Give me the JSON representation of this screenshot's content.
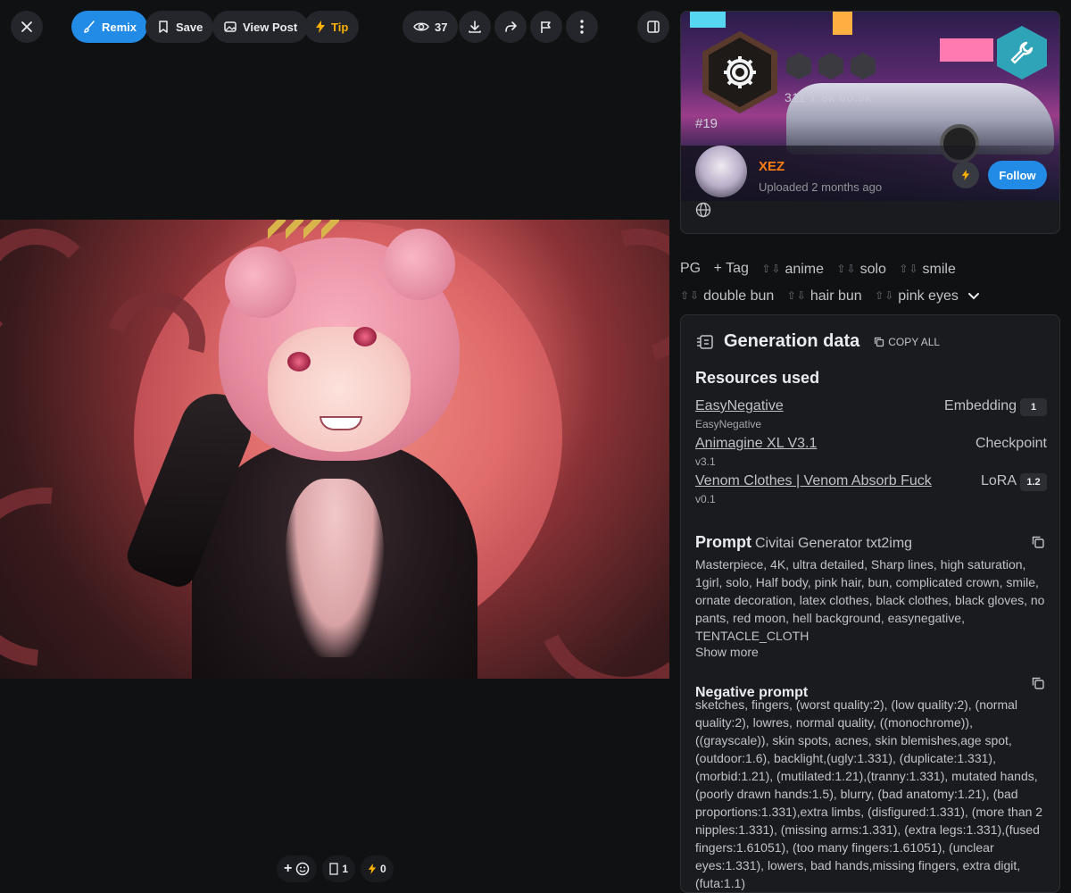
{
  "toolbar": {
    "remix": "Remix",
    "save": "Save",
    "view_post": "View Post",
    "tip": "Tip",
    "views": "37"
  },
  "reactions": {
    "image_count": "1",
    "buzz": "0"
  },
  "profile": {
    "stats": "311  7.8k  60.9k",
    "rank": "#19",
    "username": "XEZ",
    "uploaded": "Uploaded 2 months ago",
    "follow": "Follow"
  },
  "tags": {
    "rating": "PG",
    "add": "+ Tag",
    "items": [
      "anime",
      "solo",
      "smile",
      "double bun",
      "hair bun",
      "pink eyes"
    ]
  },
  "generation": {
    "title": "Generation data",
    "copy_all": "COPY ALL",
    "resources_title": "Resources used",
    "resources": [
      {
        "name": "EasyNegative",
        "version": "EasyNegative",
        "type": "Embedding",
        "weight": "1"
      },
      {
        "name": "Animagine XL V3.1",
        "version": "v3.1",
        "type": "Checkpoint",
        "weight": ""
      },
      {
        "name": "Venom Clothes | Venom Absorb Fuck",
        "version": "v0.1",
        "type": "LoRA",
        "weight": "1.2"
      }
    ],
    "prompt_label": "Prompt",
    "prompt_source": "Civitai Generator txt2img",
    "prompt": "Masterpiece, 4K, ultra detailed, Sharp lines, high saturation, 1girl, solo, Half body, pink hair, bun, complicated crown, smile, ornate decoration, latex clothes, black clothes, black gloves, no pants, red moon, hell background, easynegative, TENTACLE_CLOTH",
    "show_more": "Show more",
    "negative_label": "Negative prompt",
    "negative": "sketches, fingers, (worst quality:2), (low quality:2), (normal quality:2), lowres, normal quality, ((monochrome)), ((grayscale)), skin spots, acnes, skin blemishes,age spot, (outdoor:1.6), backlight,(ugly:1.331), (duplicate:1.331), (morbid:1.21), (mutilated:1.21),(tranny:1.331), mutated hands, (poorly drawn hands:1.5), blurry, (bad anatomy:1.21), (bad proportions:1.331),extra limbs, (disfigured:1.331), (more than 2 nipples:1.331), (missing arms:1.331), (extra legs:1.331),(fused fingers:1.61051), (too many fingers:1.61051), (unclear eyes:1.331), lowers, bad hands,missing fingers, extra digit, (futa:1.1)"
  }
}
